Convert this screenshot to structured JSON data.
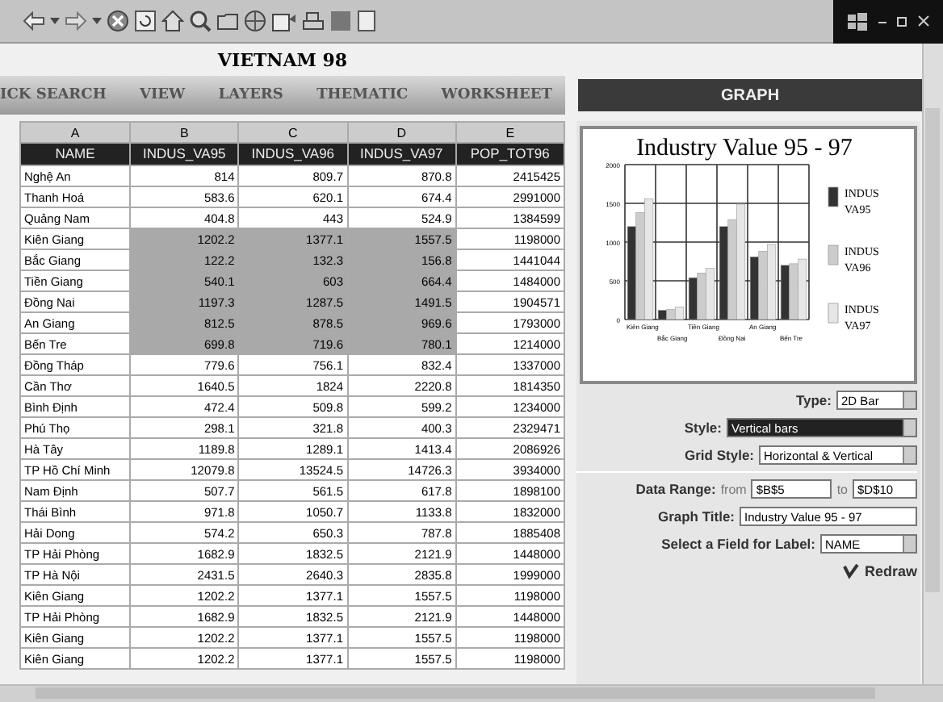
{
  "app_title": "VIETNAM 98",
  "tabs": [
    {
      "label": "ICK SEARCH",
      "selected": false
    },
    {
      "label": "VIEW",
      "selected": false
    },
    {
      "label": "LAYERS",
      "selected": false
    },
    {
      "label": "THEMATIC",
      "selected": false
    },
    {
      "label": "WORKSHEET",
      "selected": false
    }
  ],
  "graph_tab": {
    "label": "GRAPH",
    "selected": true
  },
  "table": {
    "column_letters": [
      "A",
      "B",
      "C",
      "D",
      "E"
    ],
    "columns": [
      "NAME",
      "INDUS_VA95",
      "INDUS_VA96",
      "INDUS_VA97",
      "POP_TOT96"
    ],
    "rows": [
      {
        "cells": [
          "Nghệ An",
          "814",
          "809.7",
          "870.8",
          "2415425"
        ],
        "selected": false
      },
      {
        "cells": [
          "Thanh Hoá",
          "583.6",
          "620.1",
          "674.4",
          "2991000"
        ],
        "selected": false
      },
      {
        "cells": [
          "Quảng Nam",
          "404.8",
          "443",
          "524.9",
          "1384599"
        ],
        "selected": false
      },
      {
        "cells": [
          "Kiên Giang",
          "1202.2",
          "1377.1",
          "1557.5",
          "1198000"
        ],
        "selected": true
      },
      {
        "cells": [
          "Bắc Giang",
          "122.2",
          "132.3",
          "156.8",
          "1441044"
        ],
        "selected": true
      },
      {
        "cells": [
          "Tiền Giang",
          "540.1",
          "603",
          "664.4",
          "1484000"
        ],
        "selected": true
      },
      {
        "cells": [
          "Đồng Nai",
          "1197.3",
          "1287.5",
          "1491.5",
          "1904571"
        ],
        "selected": true
      },
      {
        "cells": [
          "An Giang",
          "812.5",
          "878.5",
          "969.6",
          "1793000"
        ],
        "selected": true
      },
      {
        "cells": [
          "Bến Tre",
          "699.8",
          "719.6",
          "780.1",
          "1214000"
        ],
        "selected": true
      },
      {
        "cells": [
          "Đồng Tháp",
          "779.6",
          "756.1",
          "832.4",
          "1337000"
        ],
        "selected": false
      },
      {
        "cells": [
          "Cần Thơ",
          "1640.5",
          "1824",
          "2220.8",
          "1814350"
        ],
        "selected": false
      },
      {
        "cells": [
          "Bình Định",
          "472.4",
          "509.8",
          "599.2",
          "1234000"
        ],
        "selected": false
      },
      {
        "cells": [
          "Phú Thọ",
          "298.1",
          "321.8",
          "400.3",
          "2329471"
        ],
        "selected": false
      },
      {
        "cells": [
          "Hà Tây",
          "1189.8",
          "1289.1",
          "1413.4",
          "2086926"
        ],
        "selected": false
      },
      {
        "cells": [
          "TP Hồ Chí Minh",
          "12079.8",
          "13524.5",
          "14726.3",
          "3934000"
        ],
        "selected": false
      },
      {
        "cells": [
          "Nam Định",
          "507.7",
          "561.5",
          "617.8",
          "1898100"
        ],
        "selected": false
      },
      {
        "cells": [
          "Thái Bình",
          "971.8",
          "1050.7",
          "1133.8",
          "1832000"
        ],
        "selected": false
      },
      {
        "cells": [
          "Hải Dong",
          "574.2",
          "650.3",
          "787.8",
          "1885408"
        ],
        "selected": false
      },
      {
        "cells": [
          "TP Hải Phòng",
          "1682.9",
          "1832.5",
          "2121.9",
          "1448000"
        ],
        "selected": false
      },
      {
        "cells": [
          "TP Hà Nội",
          "2431.5",
          "2640.3",
          "2835.8",
          "1999000"
        ],
        "selected": false
      },
      {
        "cells": [
          "Kiên Giang",
          "1202.2",
          "1377.1",
          "1557.5",
          "1198000"
        ],
        "selected": false
      },
      {
        "cells": [
          "TP Hải Phòng",
          "1682.9",
          "1832.5",
          "2121.9",
          "1448000"
        ],
        "selected": false
      },
      {
        "cells": [
          "Kiên Giang",
          "1202.2",
          "1377.1",
          "1557.5",
          "1198000"
        ],
        "selected": false
      },
      {
        "cells": [
          "Kiên Giang",
          "1202.2",
          "1377.1",
          "1557.5",
          "1198000"
        ],
        "selected": false
      }
    ]
  },
  "graph": {
    "chart_data": {
      "type": "bar",
      "title": "Industry Value 95 - 97",
      "categories": [
        "Kiên Giang",
        "Bắc Giang",
        "Tiền Giang",
        "Đồng Nai",
        "An Giang",
        "Bến Tre"
      ],
      "series": [
        {
          "name": "INDUS VA95",
          "color": "#333333",
          "values": [
            1200,
            120,
            540,
            1200,
            810,
            700
          ]
        },
        {
          "name": "INDUS VA96",
          "color": "#cccccc",
          "values": [
            1380,
            130,
            600,
            1290,
            880,
            720
          ]
        },
        {
          "name": "INDUS VA97",
          "color": "#e6e6e6",
          "values": [
            1560,
            160,
            660,
            1490,
            970,
            780
          ]
        }
      ],
      "ylim": [
        0,
        2000
      ],
      "yticks": [
        0,
        500,
        1000,
        1500,
        2000
      ],
      "grid": true,
      "legend": true
    }
  },
  "form": {
    "type": {
      "label": "Type:",
      "value": "2D Bar"
    },
    "style": {
      "label": "Style:",
      "value": "Vertical bars",
      "focused": true
    },
    "grid_style": {
      "label": "Grid Style:",
      "value": "Horizontal & Vertical"
    },
    "data_range": {
      "label": "Data Range:",
      "from_label": "from",
      "from_value": "$B$5",
      "to_label": "to",
      "to_value": "$D$10"
    },
    "graph_title": {
      "label": "Graph Title:",
      "value": "Industry Value 95 - 97"
    },
    "label_field": {
      "label": "Select a Field for Label:",
      "value": "NAME"
    },
    "redraw": "Redraw"
  }
}
